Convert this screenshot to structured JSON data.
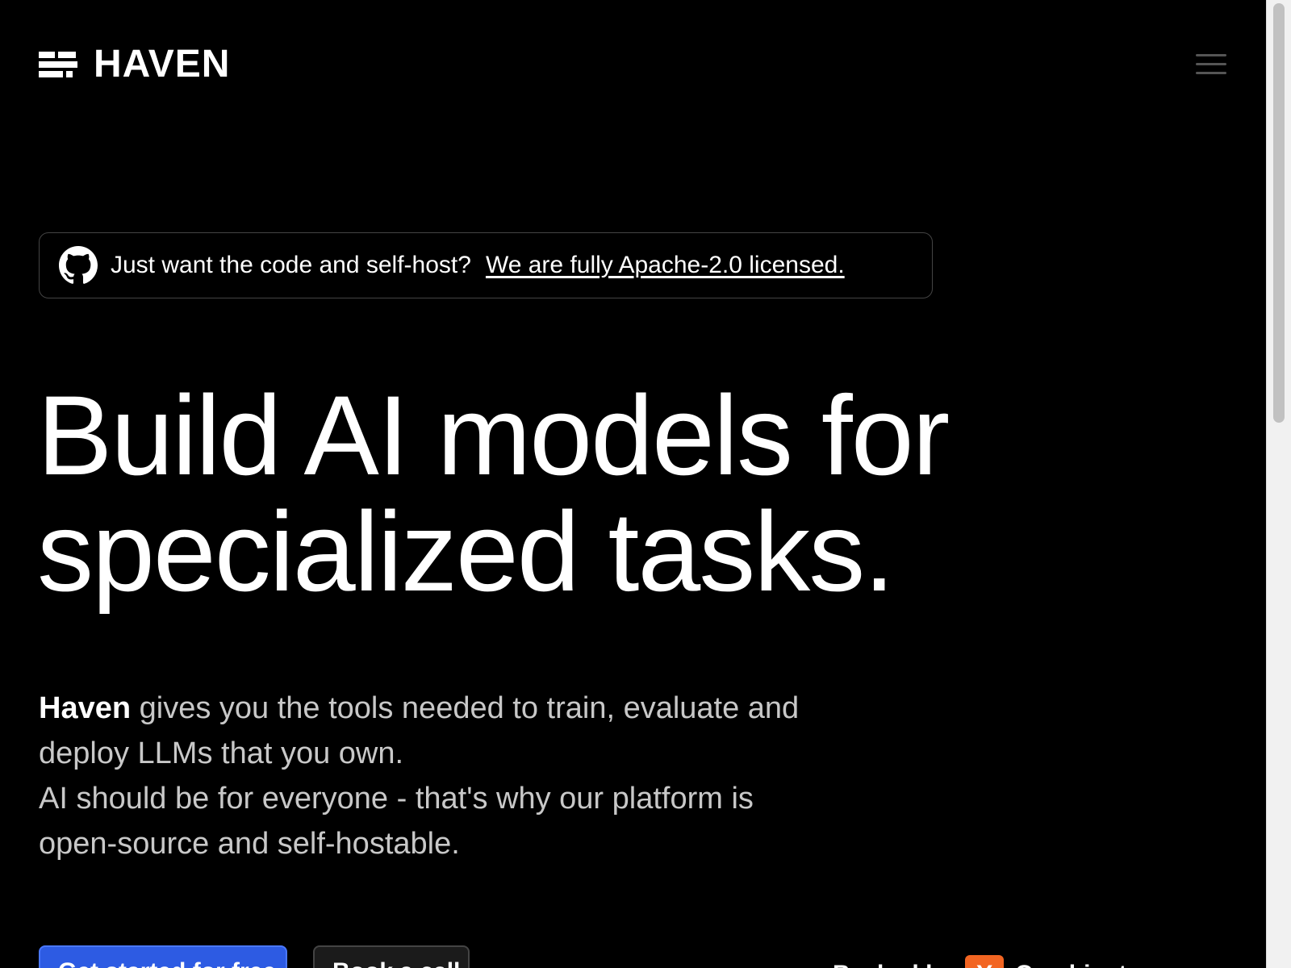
{
  "header": {
    "brand": "HAVEN",
    "logo_icon": "haven-logo-icon",
    "menu_icon": "hamburger-menu-icon"
  },
  "banner": {
    "icon": "github-icon",
    "text": "Just want the code and self-host?",
    "link": "We are fully Apache-2.0 licensed."
  },
  "hero": {
    "title_line1": "Build AI models for",
    "title_line2": "specialized tasks.",
    "desc_brand": "Haven",
    "desc_line1_rest": " gives you the tools needed to train, evaluate and",
    "desc_line2": "deploy LLMs that you own.",
    "desc_line3": "AI should be for everyone - that's why our platform is",
    "desc_line4": "open-source and self-hostable."
  },
  "cta": {
    "primary_label": "Get started for free",
    "secondary_label": "Book a call",
    "backed_label": "Backed by",
    "yc_badge": "Y",
    "yc_name": "Combinator"
  },
  "colors": {
    "background": "#000000",
    "primary_button": "#2d5be3",
    "yc_orange": "#f26522",
    "muted_text": "#c8c8c8"
  }
}
